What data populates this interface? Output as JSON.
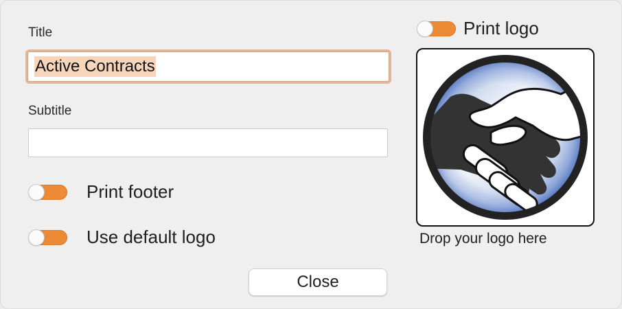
{
  "form": {
    "title_label": "Title",
    "title_value": "Active Contracts",
    "subtitle_label": "Subtitle",
    "subtitle_value": "",
    "subtitle_placeholder": ""
  },
  "options": {
    "print_footer_label": "Print footer",
    "print_footer_on": true,
    "use_default_logo_label": "Use default logo",
    "use_default_logo_on": true,
    "print_logo_label": "Print logo",
    "print_logo_on": true
  },
  "logo": {
    "icon": "handshake-icon",
    "drop_caption": "Drop your logo here"
  },
  "actions": {
    "close_label": "Close"
  },
  "colors": {
    "accent": "#ec8a35",
    "focus_ring": "#e4b598",
    "selection": "#f6d5bb",
    "logo_blue": "#3b63b8"
  }
}
